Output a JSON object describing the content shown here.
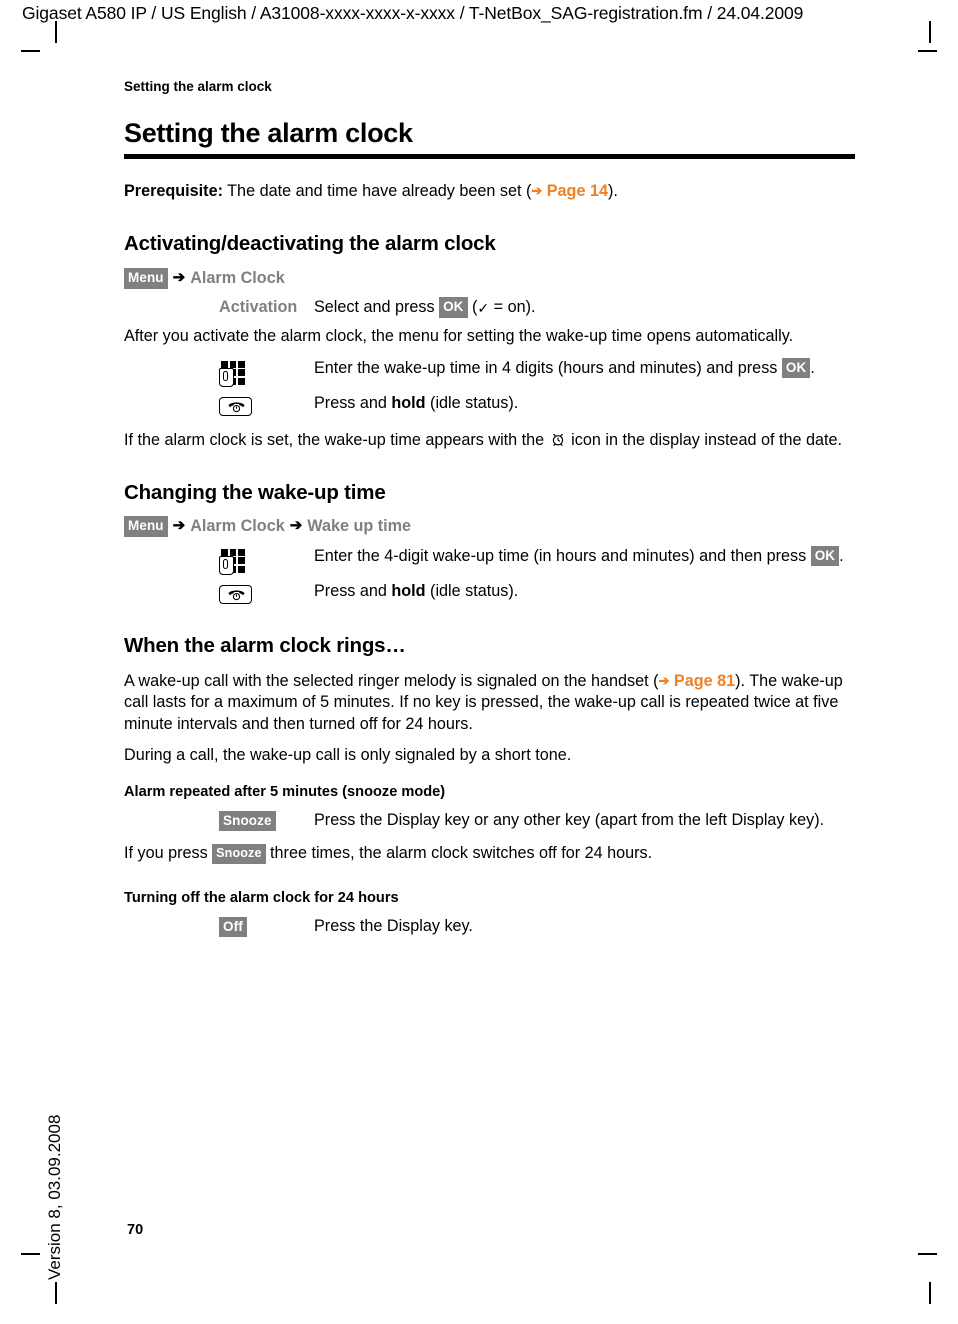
{
  "document": {
    "file_header": "Gigaset A580 IP / US English / A31008-xxxx-xxxx-x-xxxx / T-NetBox_SAG-registration.fm / 24.04.2009",
    "running_head": "Setting the alarm clock",
    "version_note": "Version 8, 03.09.2008",
    "page_number": "70",
    "link_color": "#F08122",
    "softkey_bg": "#808080",
    "menupath_color": "#808080"
  },
  "chapter": {
    "title": "Setting the alarm clock",
    "prerequisite_label": "Prerequisite:",
    "prerequisite_text": " The date and time have already been set (",
    "prerequisite_arrow": "➔",
    "prerequisite_link": "Page 14",
    "prerequisite_tail": ")."
  },
  "section_activating": {
    "heading": "Activating/deactivating the alarm clock",
    "path": {
      "softkey": "Menu",
      "arrow1": "➔",
      "item1": "Alarm Clock"
    },
    "activation_row": {
      "label": "Activation",
      "text_before": "Select and press ",
      "softkey": "OK",
      "text_after_open": " (",
      "check": "✓",
      "text_after": " = on)."
    },
    "after_paragraph": "After you activate the alarm clock, the menu for setting the wake-up time opens automatically.",
    "keypad_row": {
      "icon": "keypad-icon",
      "text_before": "Enter the wake-up time in 4 digits (hours and minutes) and press ",
      "softkey": "OK",
      "text_after": "."
    },
    "endcall_row": {
      "icon": "end-call-key-icon",
      "text_before": "Press and ",
      "bold": "hold",
      "text_after": " (idle status)."
    },
    "note_before": "If the alarm clock is set, the wake-up time appears with the ",
    "note_icon": "alarm-clock-icon",
    "note_after": " icon in the display instead of the date."
  },
  "section_changing": {
    "heading": "Changing the wake-up time",
    "path": {
      "softkey": "Menu",
      "arrow1": "➔",
      "item1": "Alarm Clock",
      "arrow2": "➔",
      "item2": "Wake up time"
    },
    "keypad_row": {
      "icon": "keypad-icon",
      "text_before": "Enter the 4-digit wake-up time (in hours and minutes) and then press ",
      "softkey": "OK",
      "text_after": "."
    },
    "endcall_row": {
      "icon": "end-call-key-icon",
      "text_before": "Press and ",
      "bold": "hold",
      "text_after": " (idle status)."
    }
  },
  "section_rings": {
    "heading": "When the alarm clock rings…",
    "paragraph1_a": "A wake-up call with the selected ringer melody is signaled on the handset (",
    "paragraph1_arrow": "➔",
    "paragraph1_link": "Page 81",
    "paragraph1_b": "). The wake-up call lasts for a maximum of 5 minutes. If no key is pressed, the wake-up call is repeated twice at five minute intervals and then turned off for 24 hours.",
    "paragraph2": "During a call, the wake-up call is only signaled by a short tone.",
    "snooze": {
      "heading": "Alarm repeated after 5 minutes (snooze mode)",
      "softkey": "Snooze",
      "description": "Press the Display key or any other key (apart from the left Display key).",
      "note_before": "If you press ",
      "note_softkey": "Snooze",
      "note_after": " three times, the alarm clock switches off for 24 hours."
    },
    "turning_off": {
      "heading": "Turning off the alarm clock for 24 hours",
      "softkey": "Off",
      "description": "Press the Display key."
    }
  }
}
